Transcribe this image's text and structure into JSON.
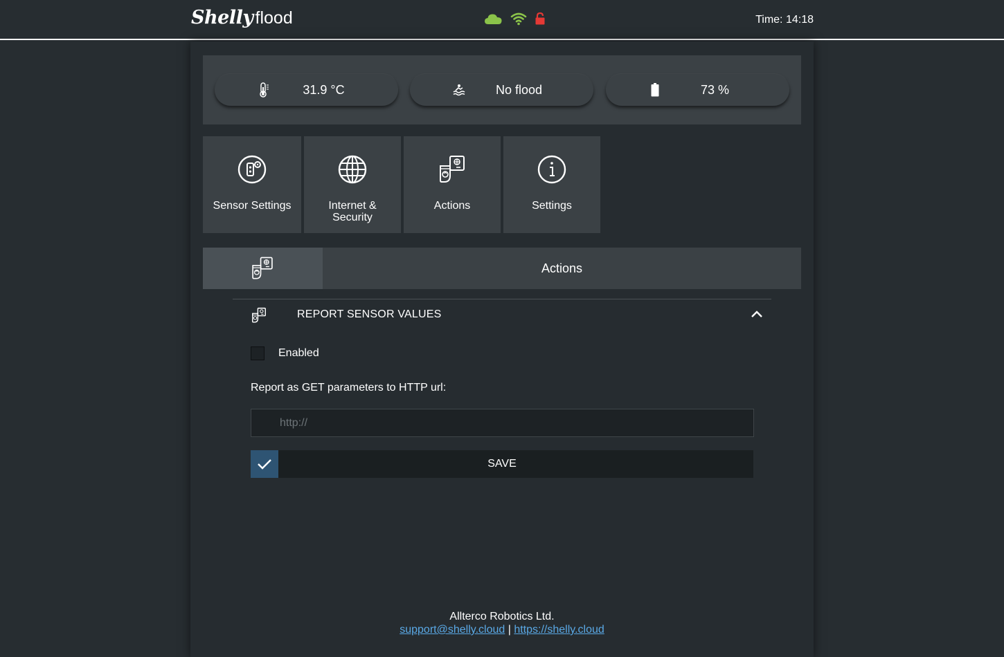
{
  "header": {
    "logo_brand": "Shelly",
    "logo_product": "flood",
    "time_label": "Time:",
    "time_value": "14:18",
    "status_icons": [
      "cloud-icon",
      "wifi-icon",
      "lock-icon"
    ],
    "colors": {
      "cloud": "#8bc34a",
      "wifi": "#8bc34a",
      "lock": "#e53935"
    }
  },
  "sensors": [
    {
      "icon": "thermometer-icon",
      "value": "31.9 °C"
    },
    {
      "icon": "flood-icon",
      "value": "No flood"
    },
    {
      "icon": "battery-icon",
      "value": "73 %"
    }
  ],
  "tiles": [
    {
      "icon": "sensor-settings-icon",
      "label": "Sensor Settings"
    },
    {
      "icon": "globe-icon",
      "label": "Internet & Security"
    },
    {
      "icon": "actions-icon",
      "label": "Actions"
    },
    {
      "icon": "info-icon",
      "label": "Settings"
    }
  ],
  "section": {
    "icon": "actions-icon",
    "title": "Actions"
  },
  "action": {
    "title": "REPORT SENSOR VALUES",
    "enabled_label": "Enabled",
    "enabled": false,
    "url_label": "Report as GET parameters to HTTP url:",
    "url_value": "",
    "url_placeholder": "http://",
    "save_label": "SAVE",
    "accent": "#2e5473"
  },
  "footer": {
    "company": "Allterco Robotics Ltd.",
    "email": "support@shelly.cloud",
    "separator": "|",
    "website": "https://shelly.cloud"
  }
}
